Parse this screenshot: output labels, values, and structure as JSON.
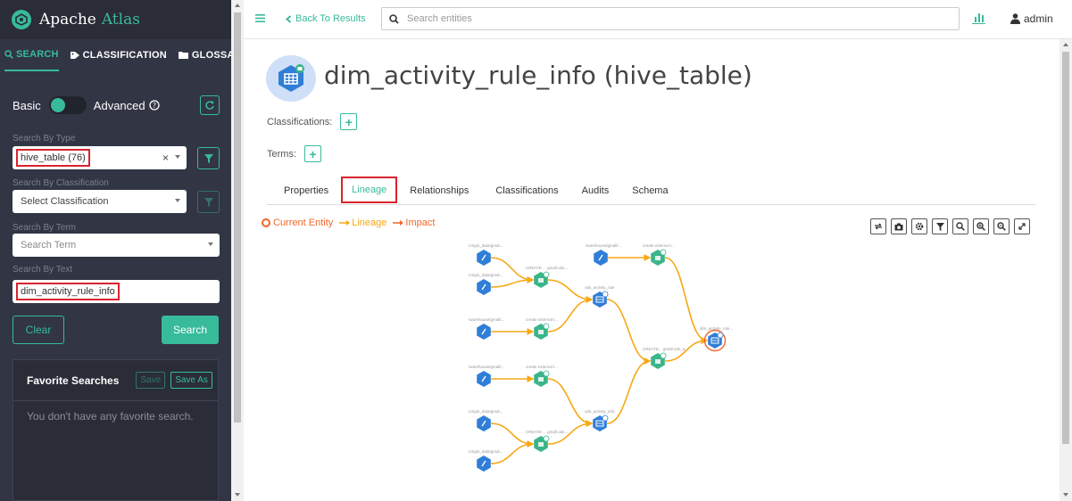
{
  "app": {
    "name_part1": "Apache",
    "name_part2": "Atlas"
  },
  "sidebar": {
    "tabs": [
      {
        "label": "SEARCH"
      },
      {
        "label": "CLASSIFICATION"
      },
      {
        "label": "GLOSSARY"
      }
    ],
    "mode_basic": "Basic",
    "mode_advanced": "Advanced",
    "search_by_type_label": "Search By Type",
    "search_by_type_value": "hive_table (76)",
    "search_by_classification_label": "Search By Classification",
    "search_by_classification_placeholder": "Select Classification",
    "search_by_term_label": "Search By Term",
    "search_by_term_placeholder": "Search Term",
    "search_by_text_label": "Search By Text",
    "search_by_text_value": "dim_activity_rule_info",
    "clear_label": "Clear",
    "search_label": "Search",
    "favorites": {
      "title": "Favorite Searches",
      "save_label": "Save",
      "save_as_label": "Save As",
      "empty_text": "You don't have any favorite search."
    }
  },
  "header": {
    "back_label": "Back To Results",
    "search_placeholder": "Search entities",
    "user": "admin"
  },
  "entity": {
    "title": "dim_activity_rule_info (hive_table)",
    "classifications_label": "Classifications:",
    "terms_label": "Terms:"
  },
  "detail_tabs": [
    {
      "label": "Properties"
    },
    {
      "label": "Lineage"
    },
    {
      "label": "Relationships"
    },
    {
      "label": "Classifications"
    },
    {
      "label": "Audits"
    },
    {
      "label": "Schema"
    }
  ],
  "legend": {
    "current": "Current Entity",
    "lineage": "Lineage",
    "impact": "Impact"
  },
  "colors": {
    "accent": "#37bb9b",
    "sidebar_bg": "#323544",
    "highlight_red": "#d9232e",
    "lineage_line": "#f7a814",
    "impact": "#f2662a",
    "node_blue": "#2f7ed8",
    "node_green": "#3bb58a"
  },
  "lineage_graph": {
    "nodes": [
      {
        "id": "n1",
        "kind": "hdfs",
        "label": "/origin_data/gmal..."
      },
      {
        "id": "n2",
        "kind": "hdfs",
        "label": "/origin_data/gmal..."
      },
      {
        "id": "n3",
        "kind": "process",
        "label": "CREATE ... gmall.ods..."
      },
      {
        "id": "n4",
        "kind": "hdfs",
        "label": "/warehouse/gmall/..."
      },
      {
        "id": "n5",
        "kind": "process",
        "label": "create external t..."
      },
      {
        "id": "n6",
        "kind": "table",
        "label": "ods_activity_rule"
      },
      {
        "id": "n7",
        "kind": "hdfs",
        "label": "/warehouse/gmall/..."
      },
      {
        "id": "n8",
        "kind": "process",
        "label": "create external t..."
      },
      {
        "id": "n9",
        "kind": "process",
        "label": "CREATE... gmall.ods_a..."
      },
      {
        "id": "n10",
        "kind": "table",
        "label": "dim_activity_rule..."
      },
      {
        "id": "n11",
        "kind": "hdfs",
        "label": "/warehouse/gmall/..."
      },
      {
        "id": "n12",
        "kind": "process",
        "label": "create external t..."
      },
      {
        "id": "n13",
        "kind": "hdfs",
        "label": "/origin_data/gmal..."
      },
      {
        "id": "n14",
        "kind": "table",
        "label": "ods_activity_info"
      },
      {
        "id": "n15",
        "kind": "process",
        "label": "CREATE ... gmall.ods..."
      },
      {
        "id": "n16",
        "kind": "hdfs",
        "label": "/origin_data/gmal..."
      }
    ]
  }
}
